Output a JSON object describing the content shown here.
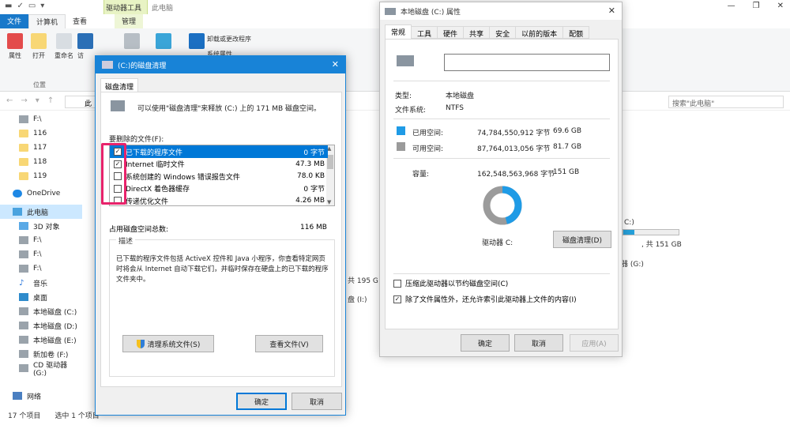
{
  "explorer": {
    "ctx_tab_label": "驱动器工具",
    "window_title": "此电脑",
    "tabs": [
      "文件",
      "计算机",
      "查看",
      "管理"
    ],
    "ribbon_items": [
      "属性",
      "打开",
      "重命名",
      "访"
    ],
    "ribbon_right_items": [
      "卸载或更改程序",
      "系统属性"
    ],
    "group_label": "位置",
    "address_text": "此",
    "search_placeholder": "搜索\"此电脑\"",
    "nav_items": [
      {
        "label": "F:\\",
        "icon": "drive"
      },
      {
        "label": "116",
        "icon": "folder"
      },
      {
        "label": "117",
        "icon": "folder"
      },
      {
        "label": "118",
        "icon": "folder"
      },
      {
        "label": "119",
        "icon": "folder"
      },
      {
        "label": "OneDrive",
        "icon": "cloud"
      },
      {
        "label": "此电脑",
        "icon": "pc"
      },
      {
        "label": "3D 对象",
        "icon": "3d"
      },
      {
        "label": "F:\\",
        "icon": "drive"
      },
      {
        "label": "F:\\",
        "icon": "drive"
      },
      {
        "label": "F:\\",
        "icon": "drive"
      },
      {
        "label": "音乐",
        "icon": "music"
      },
      {
        "label": "桌面",
        "icon": "desk"
      },
      {
        "label": "本地磁盘 (C:)",
        "icon": "drive"
      },
      {
        "label": "本地磁盘 (D:)",
        "icon": "drive"
      },
      {
        "label": "本地磁盘 (E:)",
        "icon": "drive"
      },
      {
        "label": "新加卷 (F:)",
        "icon": "drive"
      },
      {
        "label": "CD 驱动器 (G:)",
        "icon": "drive"
      },
      {
        "label": "网络",
        "icon": "net"
      }
    ],
    "status_count": "17 个项目",
    "status_selected": "选中 1 个项目",
    "bg_texts": {
      "c_label": "C:)",
      "c_free": ", 共 151 GB",
      "g_label": "器 (G:)",
      "free195": "共 195 G",
      "i_label": "盘 (I:)"
    }
  },
  "cleanup": {
    "title": "(C:)的磁盘清理",
    "tab": "磁盘清理",
    "intro": "可以使用\"磁盘清理\"来释放  (C:) 上的 171 MB 磁盘空间。",
    "files_label": "要删除的文件(F):",
    "files": [
      {
        "name": "已下载的程序文件",
        "size": "0 字节",
        "checked": true,
        "selected": true
      },
      {
        "name": "Internet 临时文件",
        "size": "47.3 MB",
        "checked": true,
        "selected": false
      },
      {
        "name": "系统创建的 Windows 错误报告文件",
        "size": "78.0 KB",
        "checked": false,
        "selected": false
      },
      {
        "name": "DirectX 着色器缓存",
        "size": "0 字节",
        "checked": false,
        "selected": false
      },
      {
        "name": "传递优化文件",
        "size": "4.26 MB",
        "checked": false,
        "selected": false
      }
    ],
    "total_label": "占用磁盘空间总数:",
    "total_value": "116 MB",
    "desc_label": "描述",
    "description": "已下载的程序文件包括 ActiveX 控件和 Java 小程序，你查看特定网页时将会从 Internet 自动下载它们，并临时保存在硬盘上的已下载的程序文件夹中。",
    "btn_clean_system": "清理系统文件(S)",
    "btn_view_files": "查看文件(V)",
    "btn_ok": "确定",
    "btn_cancel": "取消"
  },
  "props": {
    "title": "本地磁盘 (C:) 属性",
    "tabs": [
      "常规",
      "工具",
      "硬件",
      "共享",
      "安全",
      "以前的版本",
      "配额"
    ],
    "type_label": "类型:",
    "type_value": "本地磁盘",
    "fs_label": "文件系统:",
    "fs_value": "NTFS",
    "used_label": "已用空间:",
    "used_bytes": "74,784,550,912 字节",
    "used_gb": "69.6 GB",
    "free_label": "可用空间:",
    "free_bytes": "87,764,013,056 字节",
    "free_gb": "81.7 GB",
    "cap_label": "容量:",
    "cap_bytes": "162,548,563,968 字节",
    "cap_gb": "151 GB",
    "drive_label": "驱动器 C:",
    "btn_cleanup": "磁盘清理(D)",
    "chk_compress": "压缩此驱动器以节约磁盘空间(C)",
    "chk_index": "除了文件属性外，还允许索引此驱动器上文件的内容(I)",
    "compress_checked": false,
    "index_checked": true,
    "btn_ok": "确定",
    "btn_cancel": "取消",
    "btn_apply": "应用(A)",
    "used_color": "#1f9be6",
    "free_color": "#9b9b9b",
    "used_fraction": 0.46
  }
}
